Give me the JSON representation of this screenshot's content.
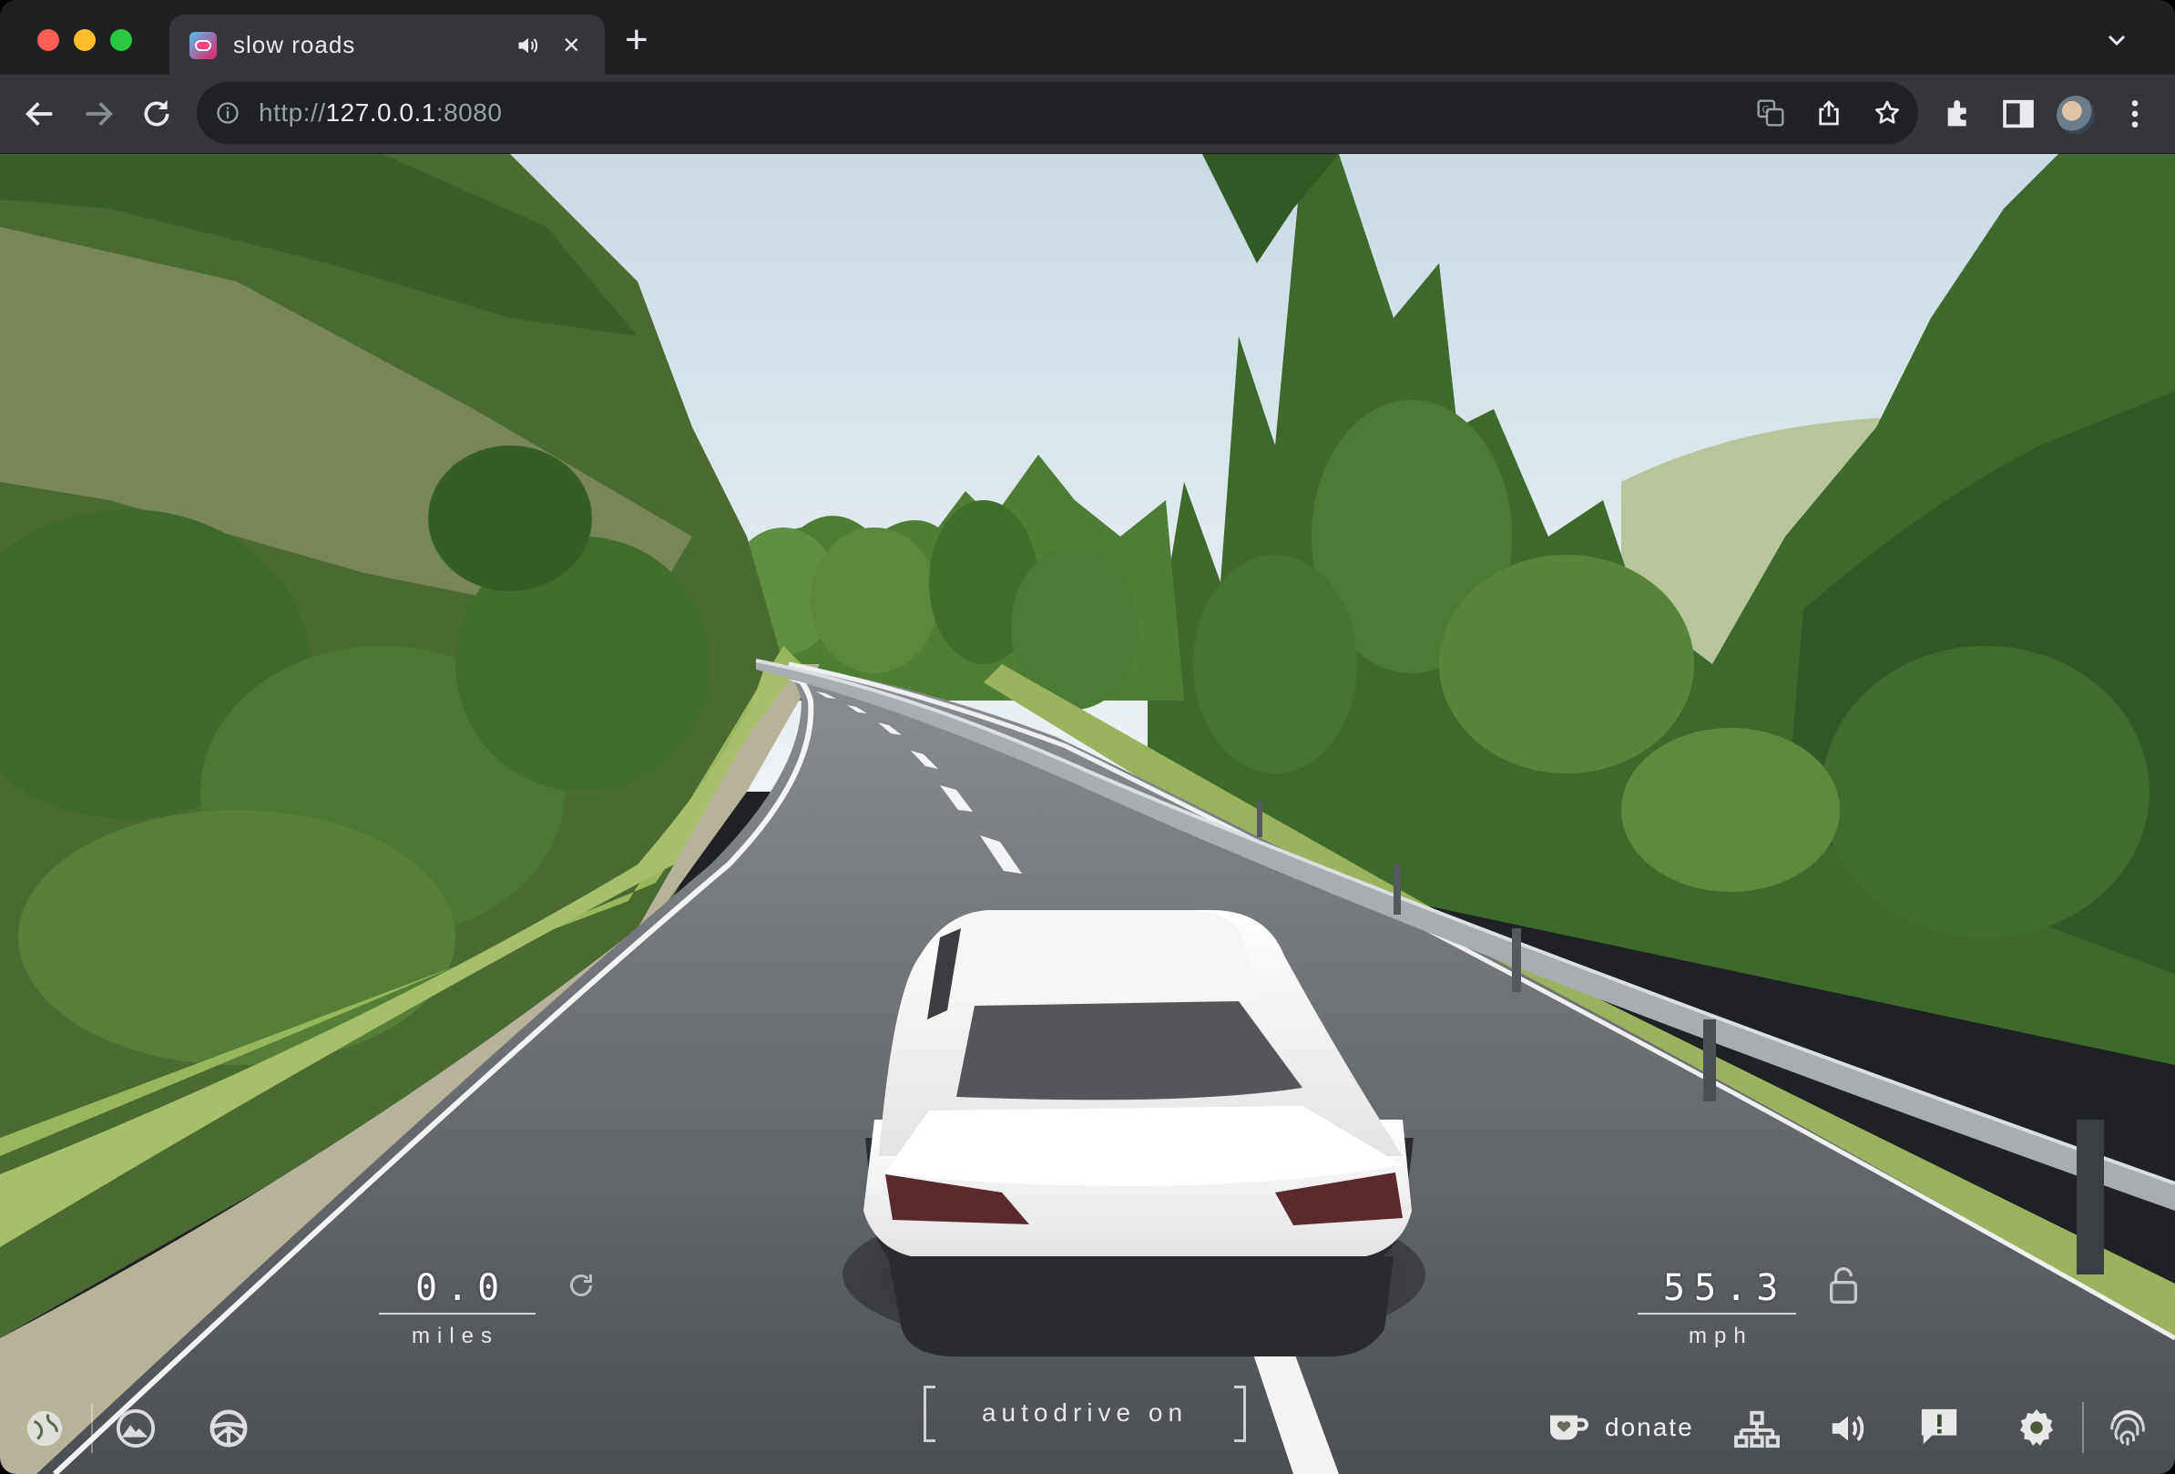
{
  "browser": {
    "tab": {
      "title": "slow roads",
      "favicon": "site-favicon",
      "audio_icon": "speaker-icon",
      "close_icon": "close-icon"
    },
    "new_tab_icon": "plus-icon",
    "tab_list_icon": "chevron-down-icon",
    "nav": {
      "back_icon": "arrow-left-icon",
      "forward_icon": "arrow-right-icon",
      "reload_icon": "reload-icon"
    },
    "omnibox": {
      "site_info_icon": "info-icon",
      "url_scheme": "http://",
      "url_host": "127.0.0.1",
      "url_port": ":8080"
    },
    "toolbar_icons": [
      "translate-icon",
      "share-icon",
      "star-icon",
      "extensions-icon",
      "side-panel-icon",
      "profile-avatar",
      "more-vert-icon"
    ]
  },
  "game": {
    "odometer": {
      "value": "0.0",
      "unit": "miles",
      "reset_icon": "reset-icon"
    },
    "speedometer": {
      "value": "55.3",
      "unit": "mph",
      "lock_icon": "lock-icon"
    },
    "autodrive": {
      "label": "autodrive on"
    },
    "left_buttons": [
      "globe-icon",
      "mountain-icon",
      "steering-wheel-icon"
    ],
    "right_buttons": {
      "donate_icon": "coffee-heart-icon",
      "donate_label": "donate",
      "icons": [
        "network-icon",
        "volume-icon",
        "feedback-icon",
        "gear-icon",
        "fingerprint-icon"
      ]
    },
    "colors": {
      "sky": "#dde8ef",
      "road": "#5d6066",
      "car": "#f4f4f4",
      "foliage": "#3f6b2e",
      "grass": "#8fae55"
    }
  }
}
